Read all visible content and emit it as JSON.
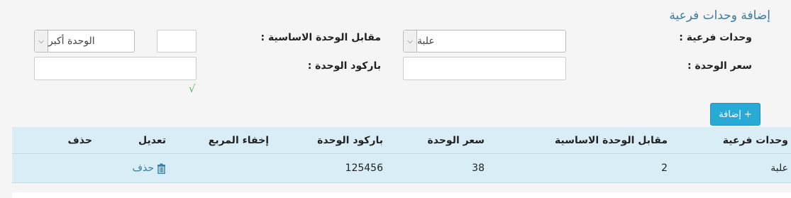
{
  "page": {
    "title": "إضافة وحدات فرعية"
  },
  "form": {
    "sub_units_label": "وحدات فرعية :",
    "sub_units_select_value": "علبة",
    "base_unit_equiv_label": "مقابل الوحدة الاساسية :",
    "base_unit_equiv_value": "",
    "larger_unit_select_value": "الوحدة أكبر",
    "unit_price_label": "سعر الوحدة :",
    "unit_price_value": "",
    "unit_barcode_label": "باركود الوحدة :",
    "unit_barcode_value": "",
    "check_mark": "√",
    "add_button_label": "+ إضافة"
  },
  "table": {
    "headers": {
      "sub_units": "وحدات فرعية",
      "base_equiv": "مقابل الوحدة الاساسية",
      "price": "سعر الوحدة",
      "barcode": "باركود الوحدة",
      "hide_box": "إخفاء المربع",
      "edit": "تعديل",
      "delete": "حذف"
    },
    "rows": [
      {
        "sub_unit": "علبة",
        "base_equiv": "2",
        "price": "38",
        "barcode": "125456",
        "hide_box": "",
        "edit_action": "حذف",
        "edit_icon": "trash-icon",
        "delete": ""
      }
    ]
  },
  "colors": {
    "title": "#3a7ca5",
    "button": "#28a9d6",
    "table_bg": "#d9edf7",
    "check": "#5cb85c"
  }
}
